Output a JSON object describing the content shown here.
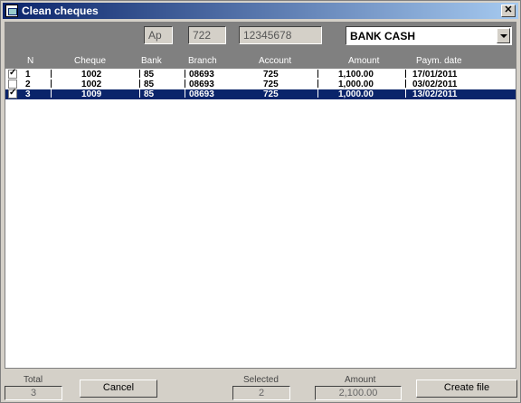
{
  "window": {
    "title": "Clean cheques",
    "close_glyph": "✕"
  },
  "filters": {
    "ap": "Ap",
    "account": "722",
    "account_number": "12345678",
    "bank_select": "BANK CASH"
  },
  "table": {
    "columns": [
      "N",
      "Cheque",
      "Bank",
      "Branch",
      "Account",
      "Amount",
      "Paym. date"
    ],
    "rows": [
      {
        "checked": true,
        "n": "1",
        "cheque": "1002",
        "bank": "85",
        "branch": "08693",
        "account": "725",
        "amount": "1,100.00",
        "date": "17/01/2011",
        "selected": false
      },
      {
        "checked": false,
        "n": "2",
        "cheque": "1002",
        "bank": "85",
        "branch": "08693",
        "account": "725",
        "amount": "1,000.00",
        "date": "03/02/2011",
        "selected": false
      },
      {
        "checked": true,
        "n": "3",
        "cheque": "1009",
        "bank": "85",
        "branch": "08693",
        "account": "725",
        "amount": "1,000.00",
        "date": "13/02/2011",
        "selected": true
      }
    ]
  },
  "footer": {
    "total_label": "Total",
    "total_value": "3",
    "cancel_label": "Cancel",
    "selected_label": "Selected",
    "selected_value": "2",
    "amount_label": "Amount",
    "amount_value": "2,100.00",
    "create_label": "Create file"
  }
}
